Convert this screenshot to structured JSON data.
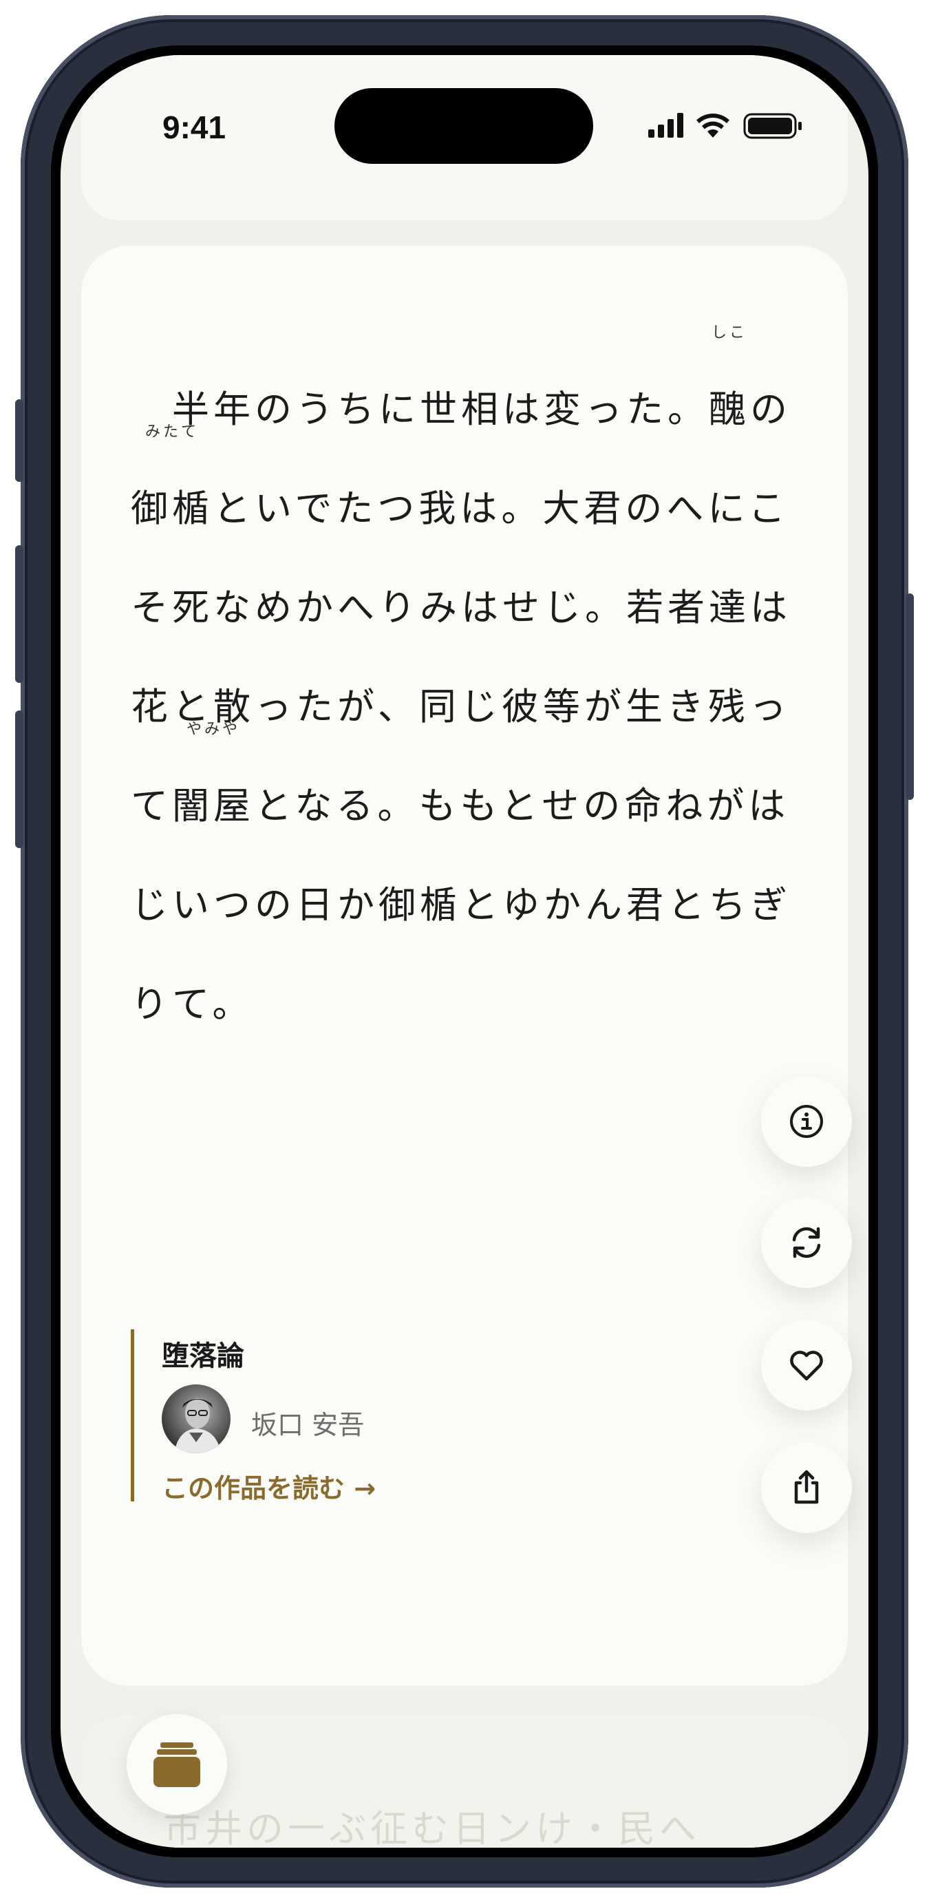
{
  "status_bar": {
    "time": "9:41"
  },
  "poem": {
    "lines": [
      {
        "pre": "　半年のうちに世相は変った。",
        "kanji": "醜",
        "ruby": "しこ",
        "post": "の"
      },
      {
        "pre": "",
        "kanji": "御楯",
        "ruby": "みたて",
        "post": "といでたつ我は。大君のへにこ"
      },
      {
        "text": "そ死なめかへりみはせじ。若者達は"
      },
      {
        "text": "花と散ったが、同じ彼等が生き残っ"
      },
      {
        "pre": "て",
        "kanji": "闇屋",
        "ruby": "やみや",
        "post": "となる。ももとせの命ねがは"
      },
      {
        "text": "じいつの日か御楯とゆかん君とちぎ"
      },
      {
        "text": "りて。"
      }
    ]
  },
  "work": {
    "title": "堕落論",
    "author": "坂口 安吾",
    "read_link": "この作品を読む →"
  },
  "actions": {
    "info_icon": "info-icon",
    "refresh_icon": "refresh-icon",
    "favorite_icon": "heart-icon",
    "share_icon": "share-icon"
  },
  "next_card_preview": "市井の一ぶ征む日ンけ・民へ",
  "colors": {
    "accent": "#8b6a2e",
    "card": "#fbfbf8",
    "screen": "#f1f1ec"
  }
}
